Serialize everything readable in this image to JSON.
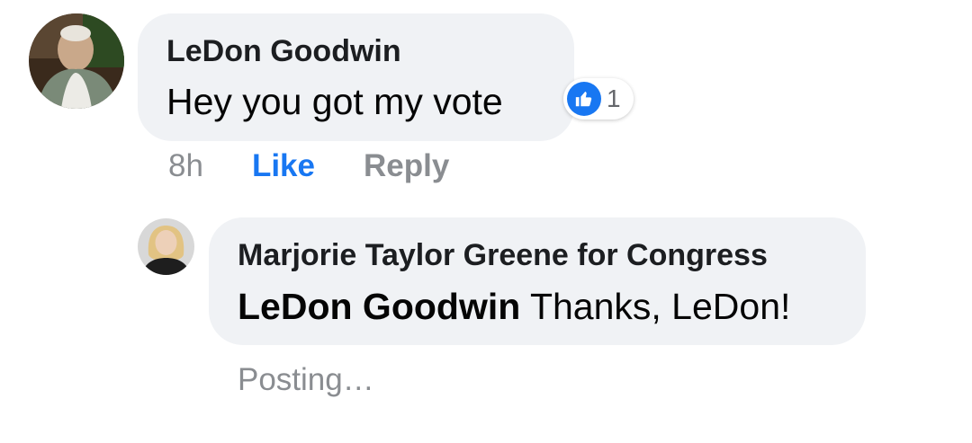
{
  "comment": {
    "author": "LeDon Goodwin",
    "text": "Hey you got my vote",
    "reaction_count": "1",
    "reaction_icon": "thumbs-up-icon",
    "timestamp": "8h",
    "like_label": "Like",
    "reply_label": "Reply"
  },
  "reply": {
    "author": "Marjorie Taylor Greene for Congress",
    "mention": "LeDon Goodwin",
    "text": " Thanks, LeDon!",
    "status": "Posting…"
  },
  "colors": {
    "bubble": "#f0f2f5",
    "accent_blue": "#1877f2",
    "meta_gray": "#8a8d91"
  }
}
